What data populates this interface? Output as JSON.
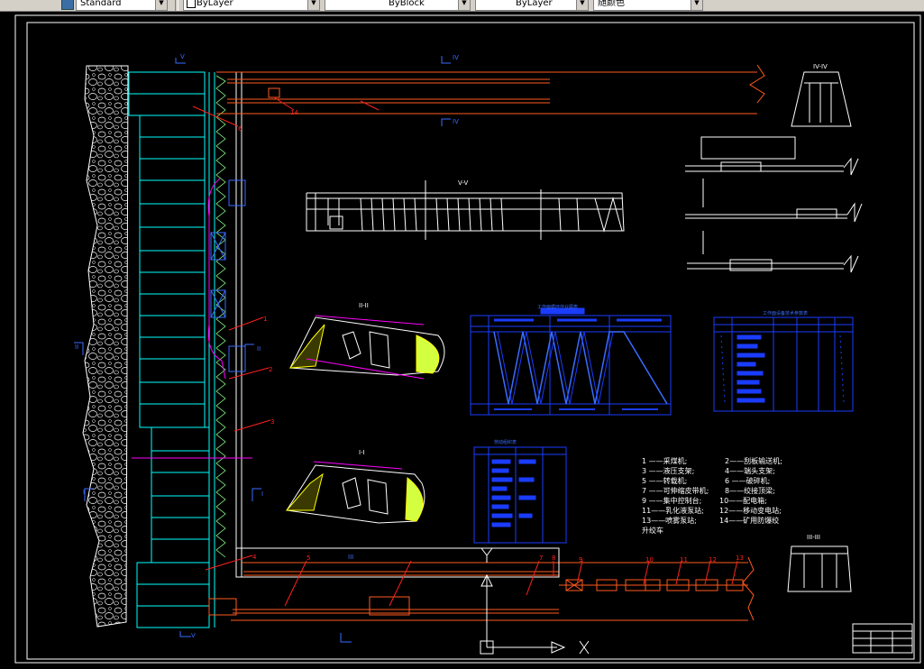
{
  "toolbar": {
    "textstyle": "Standard",
    "layer_color": "ByLayer",
    "linetype": "ByBlock",
    "lineweight": "ByLayer",
    "plotstyle": "随颜色"
  },
  "drawing": {
    "section_labels": {
      "sec_iv_top": "IV-IV",
      "sec_v": "V-V",
      "sec_ii": "II-II",
      "sec_i": "I-I",
      "sec_iii": "III-III",
      "mark_iv_a": "IV",
      "mark_iv_b": "IV",
      "mark_v_a": "V",
      "mark_v_b": "V",
      "mark_ii_a": "II",
      "mark_ii_b": "II",
      "mark_i_a": "I",
      "mark_i_b": "I",
      "mark_iii": "III"
    },
    "callouts": [
      "1",
      "2",
      "3",
      "4",
      "5",
      "6",
      "7",
      "8",
      "9",
      "10",
      "11",
      "12",
      "13",
      "14"
    ],
    "legend": {
      "items": [
        "1 ——采煤机;",
        "2——刮板输送机;",
        "3 ——液压支架;",
        "4——端头支架;",
        "5 ——转载机;",
        "6 ——破碎机;",
        "7 ——可伸缩皮带机;",
        "8——绞接顶梁;",
        "9 ——集中控制台;",
        "10——配电箱;",
        "11——乳化液泵站;",
        "12——移动变电站;",
        "13——喷雾泵站;",
        "14——矿用防爆绞",
        "升绞车"
      ]
    },
    "table_right_title": "工作面设备技术参数表",
    "table_center_title": "工作面循环作业图表",
    "table_left_title": "劳动组织表"
  },
  "colors": {
    "background": "#000000",
    "cyan": "#00ffff",
    "orange": "#ff5a1e",
    "blue": "#1a3cff",
    "white": "#ffffff",
    "magenta": "#ff00ff",
    "yellow": "#ffff00",
    "green": "#00ff00",
    "red": "#ff2020"
  }
}
